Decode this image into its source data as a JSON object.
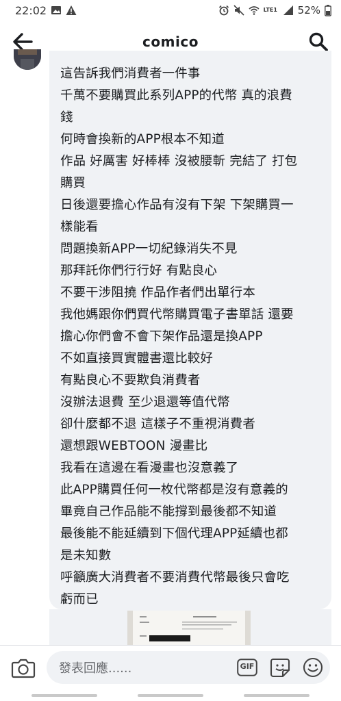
{
  "status_bar": {
    "time": "22:02",
    "battery": "52%",
    "network_label": "LTE1"
  },
  "header": {
    "title": "comico"
  },
  "comment": {
    "lines": [
      "這告訴我們消費者一件事",
      "千萬不要購買此系列APP的代幣 真的浪費",
      "錢",
      "何時會換新的APP根本不知道",
      "作品 好厲害 好棒棒 沒被腰斬 完結了 打包",
      "購買",
      "日後還要擔心作品有沒有下架 下架購買一",
      "樣能看",
      "問題換新APP一切紀錄消失不見",
      "那拜託你們行行好 有點良心",
      "不要干涉阻撓 作品作者們出單行本",
      "我他媽跟你們買代幣購買電子書單話 還要",
      "擔心你們會不會下架作品還是換APP",
      "不如直接買實體書還比較好",
      "有點良心不要欺負消費者",
      "沒辦法退費 至少退還等值代幣",
      "卻什麼都不退 這樣子不重視消費者",
      "還想跟WEBTOON 漫畫比",
      "我看在這邊在看漫畫也沒意義了",
      "此APP購買任何一枚代幣都是沒有意義的",
      "畢竟自己作品能不能撐到最後都不知道",
      "最後能不能延續到下個代理APP延續也都",
      "是未知數",
      "呼籲廣大消費者不要消費代幣最後只會吃",
      "虧而已"
    ]
  },
  "composer": {
    "placeholder": "發表回應......",
    "gif_label": "GIF"
  },
  "icons": {
    "back": "arrow-left-icon",
    "search": "search-icon",
    "camera": "camera-icon",
    "gif": "gif-icon",
    "sticker": "sticker-icon",
    "emoji": "emoji-icon"
  },
  "colors": {
    "bubble": "#f0f2f5",
    "text": "#1c1e21",
    "placeholder": "#65676b"
  }
}
